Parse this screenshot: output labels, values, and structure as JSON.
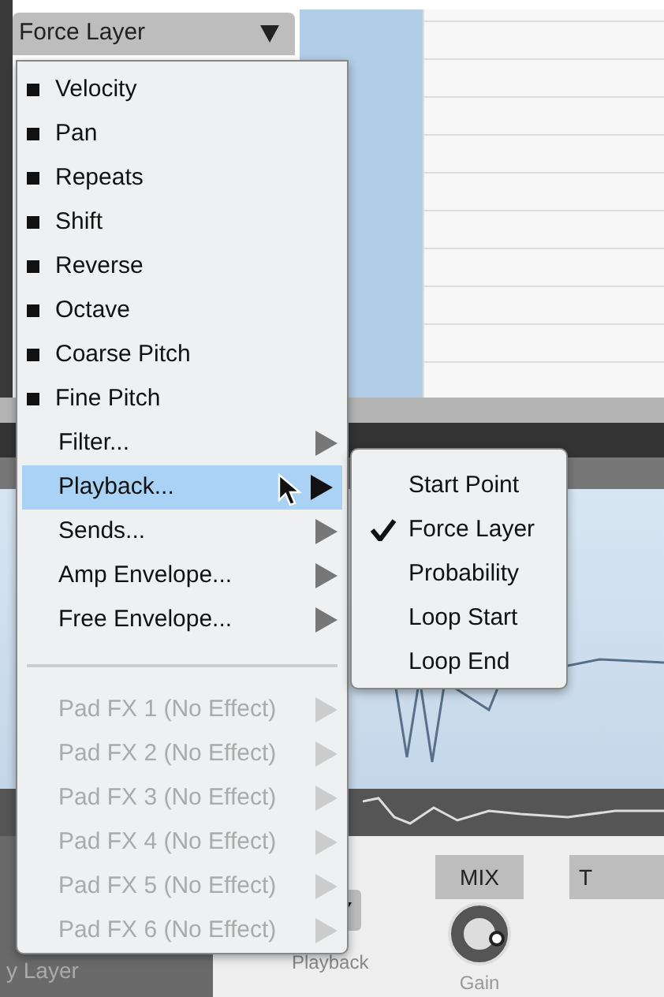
{
  "dropdown": {
    "value": "Force Layer"
  },
  "menu": {
    "sections": [
      [
        {
          "label": "Velocity",
          "kind": "bullet",
          "selected": false,
          "disabled": false
        },
        {
          "label": "Pan",
          "kind": "bullet",
          "selected": false,
          "disabled": false
        },
        {
          "label": "Repeats",
          "kind": "bullet",
          "selected": false,
          "disabled": false
        },
        {
          "label": "Shift",
          "kind": "bullet",
          "selected": false,
          "disabled": false
        },
        {
          "label": "Reverse",
          "kind": "bullet",
          "selected": false,
          "disabled": false
        },
        {
          "label": "Octave",
          "kind": "bullet",
          "selected": false,
          "disabled": false
        },
        {
          "label": "Coarse Pitch",
          "kind": "bullet",
          "selected": false,
          "disabled": false
        },
        {
          "label": "Fine Pitch",
          "kind": "bullet",
          "selected": false,
          "disabled": false
        },
        {
          "label": "Filter...",
          "kind": "submenu",
          "selected": false,
          "disabled": false
        },
        {
          "label": "Playback...",
          "kind": "submenu",
          "selected": true,
          "disabled": false
        },
        {
          "label": "Sends...",
          "kind": "submenu",
          "selected": false,
          "disabled": false
        },
        {
          "label": "Amp Envelope...",
          "kind": "submenu",
          "selected": false,
          "disabled": false
        },
        {
          "label": "Free Envelope...",
          "kind": "submenu",
          "selected": false,
          "disabled": false
        }
      ],
      [
        {
          "label": "Pad FX 1 (No Effect)",
          "kind": "submenu",
          "selected": false,
          "disabled": true
        },
        {
          "label": "Pad FX 2 (No Effect)",
          "kind": "submenu",
          "selected": false,
          "disabled": true
        },
        {
          "label": "Pad FX 3 (No Effect)",
          "kind": "submenu",
          "selected": false,
          "disabled": true
        },
        {
          "label": "Pad FX 4 (No Effect)",
          "kind": "submenu",
          "selected": false,
          "disabled": true
        },
        {
          "label": "Pad FX 5 (No Effect)",
          "kind": "submenu",
          "selected": false,
          "disabled": true
        },
        {
          "label": "Pad FX 6 (No Effect)",
          "kind": "submenu",
          "selected": false,
          "disabled": true
        }
      ]
    ]
  },
  "submenu": {
    "items": [
      {
        "label": "Start Point",
        "checked": false
      },
      {
        "label": "Force Layer",
        "checked": true
      },
      {
        "label": "Probability",
        "checked": false
      },
      {
        "label": "Loop Start",
        "checked": false
      },
      {
        "label": "Loop End",
        "checked": false
      }
    ]
  },
  "panel": {
    "layer_label": "y Layer",
    "mode_label": "Playback",
    "mix_header": "MIX",
    "next_header": "T",
    "knob_label": "Gain"
  }
}
